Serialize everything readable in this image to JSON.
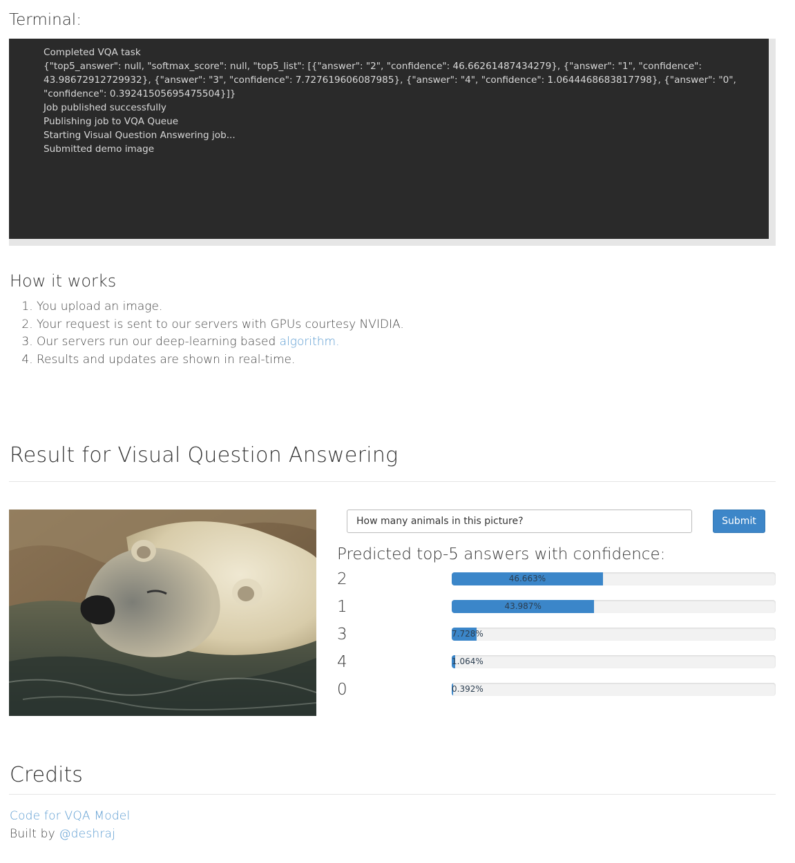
{
  "terminal": {
    "heading": "Terminal:",
    "lines": [
      "Completed VQA task",
      "{\"top5_answer\": null, \"softmax_score\": null, \"top5_list\": [{\"answer\": \"2\", \"confidence\": 46.66261487434279}, {\"answer\": \"1\", \"confidence\": 43.98672912729932}, {\"answer\": \"3\", \"confidence\": 7.727619606087985}, {\"answer\": \"4\", \"confidence\": 1.0644468683817798}, {\"answer\": \"0\", \"confidence\": 0.39241505695475504}]}",
      "Job published successfully",
      "Publishing job to VQA Queue",
      "Starting Visual Question Answering job...",
      "Submitted demo image"
    ]
  },
  "how": {
    "heading": "How it works",
    "steps": [
      "You upload an image.",
      "Your request is sent to our servers with GPUs courtesy NVIDIA.",
      "Our servers run our deep-learning based "
    ],
    "algorithm_link": "algorithm.",
    "step4": "Results and updates are shown in real-time."
  },
  "result": {
    "heading": "Result for Visual Question Answering",
    "question_value": "How many animals in this picture?",
    "submit_label": "Submit",
    "predicted_heading": "Predicted top-5 answers with confidence:",
    "answers": [
      {
        "answer": "2",
        "percent": 46.663,
        "label": "46.663%"
      },
      {
        "answer": "1",
        "percent": 43.987,
        "label": "43.987%"
      },
      {
        "answer": "3",
        "percent": 7.728,
        "label": "7.728%"
      },
      {
        "answer": "4",
        "percent": 1.064,
        "label": "1.064%"
      },
      {
        "answer": "0",
        "percent": 0.392,
        "label": "0.392%"
      }
    ],
    "bar_color": "#3b86c9"
  },
  "credits": {
    "heading": "Credits",
    "code_link": "Code for VQA Model",
    "built_by": "Built by ",
    "author_link": "@deshraj"
  }
}
